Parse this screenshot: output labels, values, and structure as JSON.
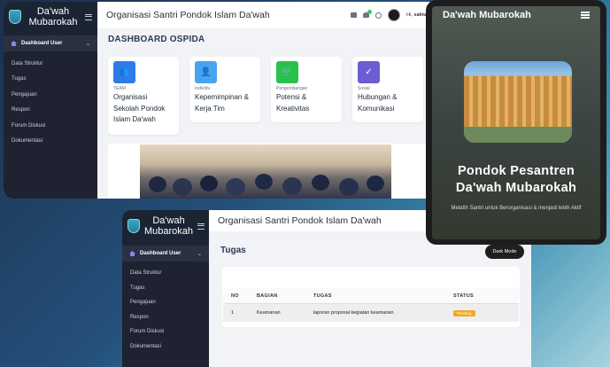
{
  "dashboard": {
    "brand": "Da'wah Mubarokah",
    "sidebar": {
      "active": "Dashboard User",
      "items": [
        "Data Struktur",
        "Tugas",
        "Pengajuan",
        "Respon",
        "Forum Diskusi",
        "Dokumentasi"
      ]
    },
    "header_title": "Organisasi Santri Pondok Islam Da'wah",
    "greeting_prefix": "Hi,",
    "user_name": "salma",
    "page_title": "DASHBOARD OSPIDA",
    "cards": [
      {
        "category": "TEAM",
        "title": "Organisasi Sekolah Pondok Islam Da'wah",
        "color": "#2f7be9",
        "icon": "team-icon"
      },
      {
        "category": "Individu",
        "title": "Kepemimpinan & Kerja Tim",
        "color": "#4aa3ee",
        "icon": "leader-icon"
      },
      {
        "category": "Pengembangan",
        "title": "Potensi & Kreativitas",
        "color": "#27c24c",
        "icon": "cart-icon"
      },
      {
        "category": "Sosial",
        "title": "Hubungan & Komunikasi",
        "color": "#6c5dd3",
        "icon": "check-circle-icon"
      }
    ]
  },
  "tugas_window": {
    "brand": "Da'wah Mubarokah",
    "header_title": "Organisasi Santri Pondok Islam Da'wah",
    "page_title": "Tugas",
    "dark_mode_label": "Dark Mode",
    "table": {
      "headers": [
        "NO",
        "BAGIAN",
        "TUGAS",
        "STATUS"
      ],
      "rows": [
        {
          "no": "1",
          "bagian": "Keamanan",
          "tugas": "laporan proposal kegiatan keamanan",
          "status": "Pending"
        }
      ]
    }
  },
  "mobile": {
    "brand": "Da'wah Mubarokah",
    "hero_title": "Pondok Pesantren Da'wah Mubarokah",
    "hero_subtitle": "Melatih Santri untuk Berorganisasi & menjadi lebih Aktif"
  }
}
